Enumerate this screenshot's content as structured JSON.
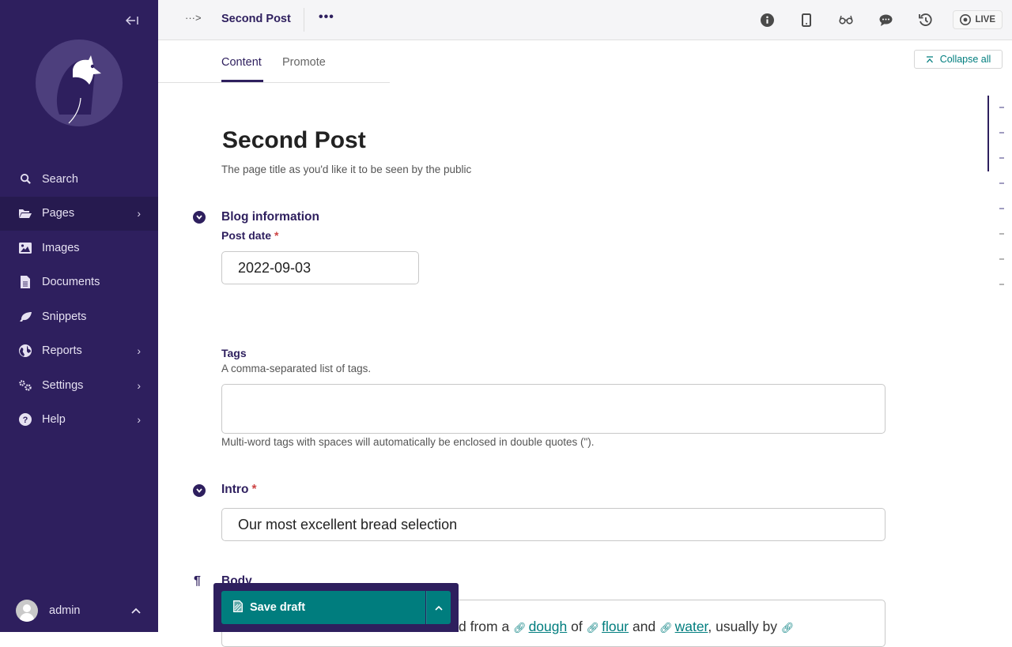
{
  "sidebar": {
    "collapse_label": "←|",
    "items": [
      {
        "label": "Search",
        "icon": "search-icon",
        "has_submenu": false
      },
      {
        "label": "Pages",
        "icon": "folder-open-icon",
        "has_submenu": true,
        "active": true
      },
      {
        "label": "Images",
        "icon": "image-icon",
        "has_submenu": false
      },
      {
        "label": "Documents",
        "icon": "document-icon",
        "has_submenu": false
      },
      {
        "label": "Snippets",
        "icon": "leaf-icon",
        "has_submenu": false
      },
      {
        "label": "Reports",
        "icon": "globe-icon",
        "has_submenu": true
      },
      {
        "label": "Settings",
        "icon": "cogs-icon",
        "has_submenu": true
      },
      {
        "label": "Help",
        "icon": "help-icon",
        "has_submenu": true
      }
    ],
    "account": {
      "username": "admin"
    }
  },
  "header": {
    "breadcrumb_toggle": "···>",
    "title": "Second Post",
    "more": "•••",
    "icons": [
      "info-icon",
      "mobile-icon",
      "glasses-icon",
      "comment-icon",
      "history-icon"
    ],
    "live_label": "LIVE"
  },
  "tabs": [
    {
      "label": "Content",
      "active": true
    },
    {
      "label": "Promote",
      "active": false
    }
  ],
  "collapse_all_label": "Collapse all",
  "form": {
    "title": "Second Post",
    "title_help": "The page title as you'd like it to be seen by the public",
    "blog_info": {
      "heading": "Blog information",
      "post_date_label": "Post date",
      "post_date_value": "2022-09-03",
      "required_mark": "*"
    },
    "tags": {
      "label": "Tags",
      "help": "A comma-separated list of tags.",
      "value": "",
      "footer_help": "Multi-word tags with spaces will automatically be enclosed in double quotes (\")."
    },
    "intro": {
      "heading": "Intro",
      "required_mark": "*",
      "value": "Our most excellent bread selection"
    },
    "body": {
      "heading": "Body",
      "pilcrow": "¶",
      "text_prefix": "d from a ",
      "link1": "dough",
      "mid1": " of ",
      "link2": "flour",
      "mid2": " and ",
      "link3": "water",
      "mid3": ", usually by "
    }
  },
  "footer": {
    "save_label": "Save draft"
  },
  "colors": {
    "sidebar_bg": "#2e1f5e",
    "accent_teal": "#007d7e",
    "heading_purple": "#2e1f5e",
    "required_red": "#cd4444"
  }
}
